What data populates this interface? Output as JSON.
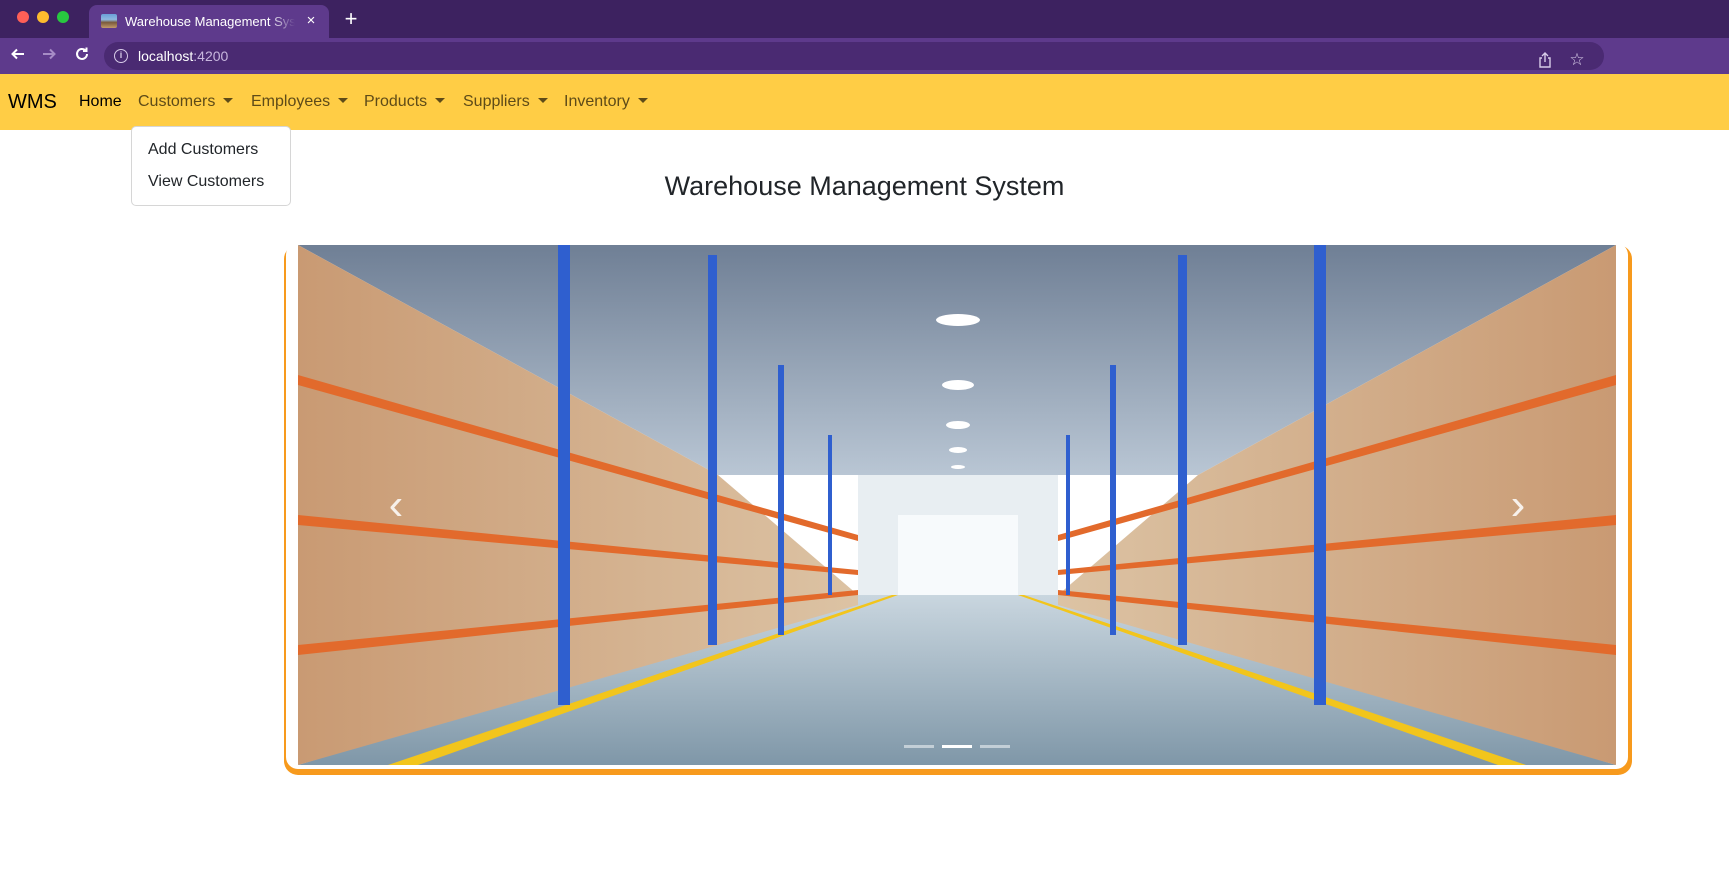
{
  "browser": {
    "tab_title": "Warehouse Management System",
    "tab_close": "×",
    "new_tab": "+",
    "url_host": "localhost",
    "url_port": ":4200"
  },
  "navbar": {
    "brand": "WMS",
    "items": [
      {
        "label": "Home",
        "active": true,
        "dropdown": false
      },
      {
        "label": "Customers",
        "active": false,
        "dropdown": true
      },
      {
        "label": "Employees",
        "active": false,
        "dropdown": true
      },
      {
        "label": "Products",
        "active": false,
        "dropdown": true
      },
      {
        "label": "Suppliers",
        "active": false,
        "dropdown": true
      },
      {
        "label": "Inventory",
        "active": false,
        "dropdown": true
      }
    ],
    "open_dropdown": {
      "menu": "Customers",
      "items": [
        "Add Customers",
        "View Customers"
      ]
    }
  },
  "main": {
    "title": "Warehouse Management System",
    "carousel": {
      "slides": 3,
      "active_slide": 2,
      "prev_glyph": "‹",
      "next_glyph": "›"
    }
  },
  "colors": {
    "browser_tabbar": "#3d2260",
    "browser_toolbar": "#5e3a8c",
    "navbar": "#ffcd45",
    "carousel_accent": "#f79a1d"
  }
}
